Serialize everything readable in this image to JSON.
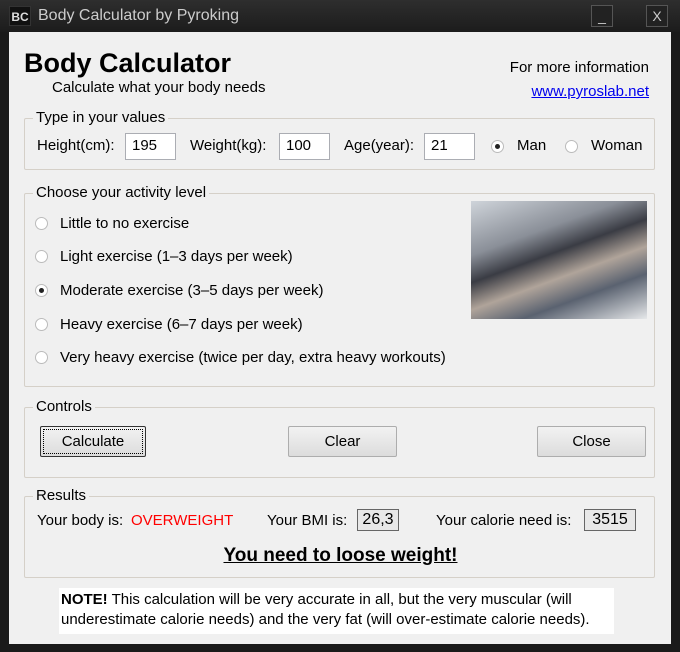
{
  "window": {
    "icon_text": "BC",
    "title": "Body Calculator by Pyroking",
    "minimize": "_",
    "close": "X"
  },
  "header": {
    "title": "Body Calculator",
    "subtitle": "Calculate what your body needs",
    "info_label": "For more information",
    "link": "www.pyroslab.net"
  },
  "values": {
    "legend": "Type in your values",
    "height_label": "Height(cm):",
    "height": "195",
    "weight_label": "Weight(kg):",
    "weight": "100",
    "age_label": "Age(year):",
    "age": "21",
    "man": "Man",
    "woman": "Woman",
    "selected_gender": "Man"
  },
  "activity": {
    "legend": "Choose your activity level",
    "options": [
      "Little to no exercise",
      "Light exercise (1–3 days per week)",
      "Moderate exercise (3–5 days per week)",
      "Heavy exercise (6–7 days per week)",
      "Very heavy exercise (twice per day, extra heavy workouts)"
    ],
    "selected_index": 2
  },
  "controls": {
    "legend": "Controls",
    "calculate": "Calculate",
    "clear": "Clear",
    "close": "Close"
  },
  "results": {
    "legend": "Results",
    "body_label": "Your body is:",
    "body_value": "OVERWEIGHT",
    "body_color": "#ff0000",
    "bmi_label": "Your BMI is:",
    "bmi": "26,3",
    "calorie_label": "Your calorie need is:",
    "calories": "3515",
    "message": "You need to loose weight!"
  },
  "note": {
    "bold": "NOTE!",
    "text": " This calculation will be very accurate in all, but the very muscular (will underestimate calorie needs) and the very fat (will over-estimate calorie needs)."
  }
}
